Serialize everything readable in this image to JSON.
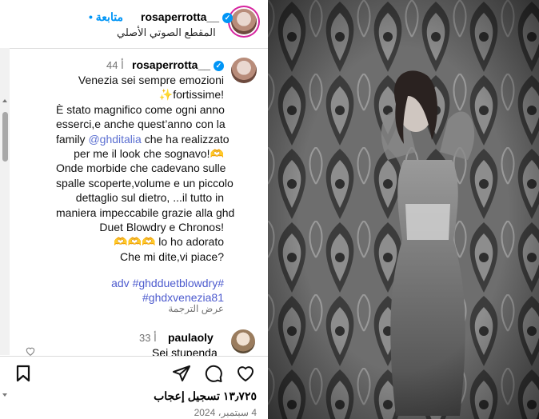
{
  "post": {
    "author": "rosaperrotta__",
    "follow_label": "• متابعة",
    "audio_label": "المقطع الصوتي الأصلي",
    "verified_glyph": "✓",
    "likes": "١٣٫٧٢٥ تسجيل إعجاب",
    "date": "4 سبتمبر، 2024"
  },
  "caption": {
    "author": "rosaperrotta__",
    "time": "44 أ",
    "lines": [
      "Venezia sei sempre emozioni",
      "✨fortissime!",
      "È stato magnifico come ogni anno",
      "esserci,e anche quest’anno con la",
      "@@family",
      "per me il look che sognavo!🫶",
      "Onde morbide che cadevano sulle",
      "spalle scoperte,volume e un piccolo",
      "dettaglio sul dietro, ...il tutto in",
      "maniera impeccabile grazie alla ghd",
      "Duet Blowdry e Chronos!",
      "🫶🫶🫶 lo ho adorato",
      "Che mi dite,vi piace?"
    ],
    "family_word": "family",
    "mention": "@ghditalia",
    "mention_after": "che ha realizzato",
    "hashtags_line1": "adv #ghdduetblowdry#",
    "hashtags_line2": "#ghdxvenezia81",
    "translate": "عرض الترجمة"
  },
  "comment": {
    "author": "paulaoly",
    "time": "33 أ",
    "text": "Sei stupenda"
  },
  "icons": {
    "like": "heart-icon",
    "comment": "comment-icon",
    "share": "share-icon",
    "save": "bookmark-icon"
  },
  "colors": {
    "accent": "#0095f6",
    "mention": "#4d5bce",
    "divider": "#dbdbdb"
  }
}
